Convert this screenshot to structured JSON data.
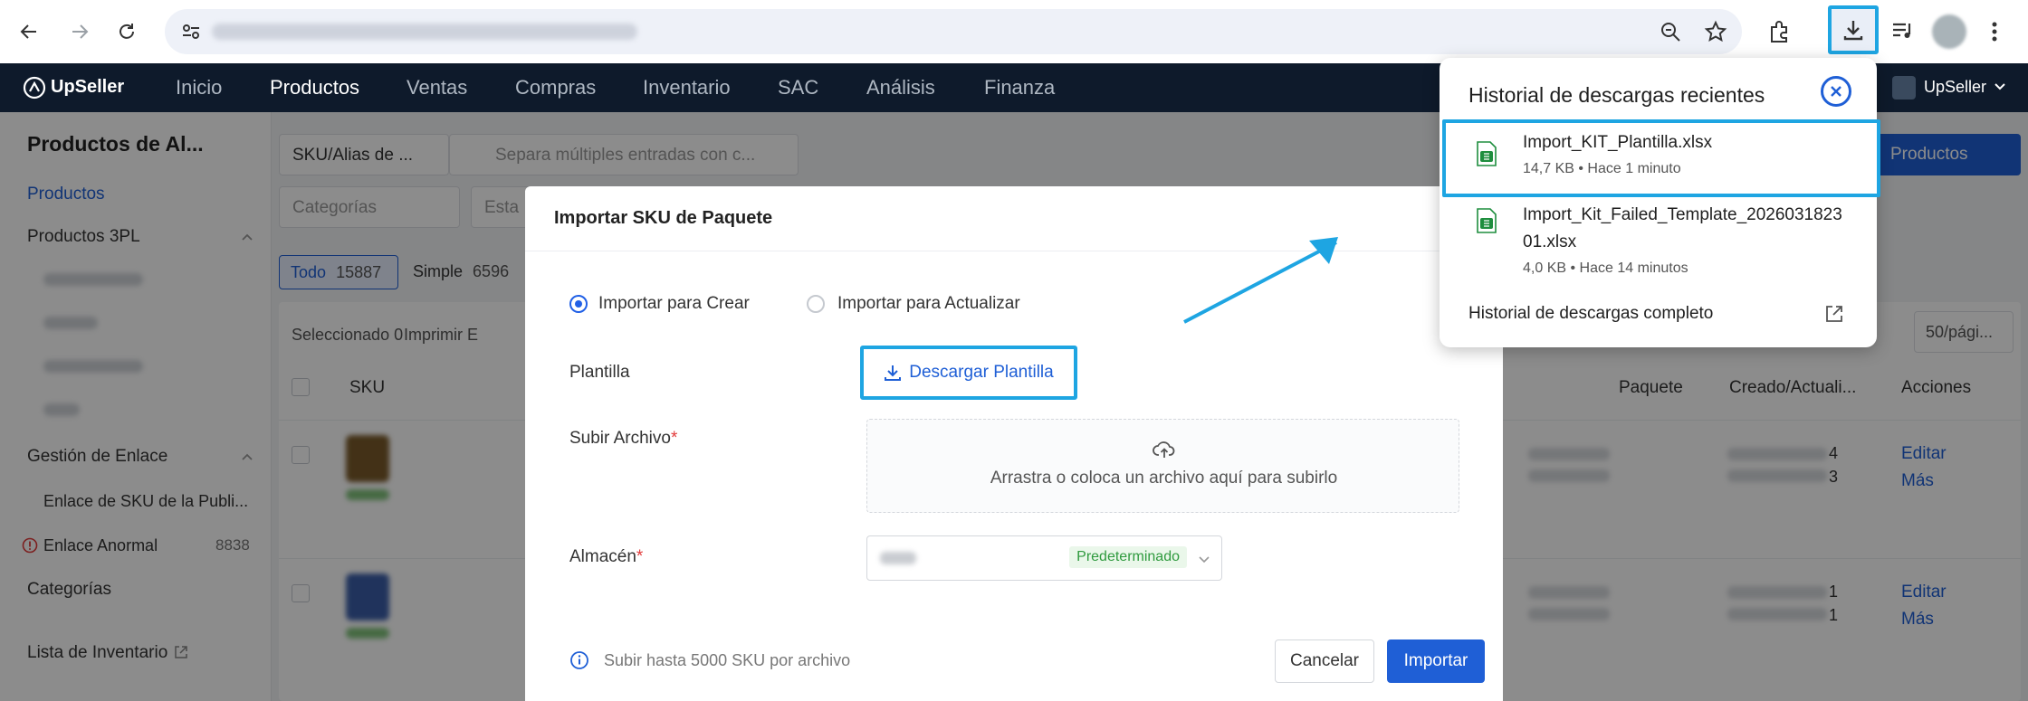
{
  "browser": {
    "icons": [
      "back-arrow-icon",
      "forward-arrow-icon",
      "reload-icon",
      "site-settings-icon",
      "zoom-icon",
      "star-icon",
      "extensions-icon",
      "download-icon",
      "media-control-icon",
      "more-vert-icon"
    ]
  },
  "app": {
    "logo": "UpSeller",
    "nav": [
      "Inicio",
      "Productos",
      "Ventas",
      "Compras",
      "Inventario",
      "SAC",
      "Análisis",
      "Finanza"
    ],
    "nav_active": "Productos",
    "account_name": "UpSeller"
  },
  "sidebar": {
    "title": "Productos de Al...",
    "items": [
      {
        "label": "Productos",
        "active": true
      },
      {
        "label": "Productos 3PL"
      },
      {
        "label": "Gestión de Enlace"
      },
      {
        "label": "Enlace de SKU de la Publi..."
      },
      {
        "label": "Enlace Anormal",
        "count": "8838"
      },
      {
        "label": "Categorías"
      },
      {
        "label": "Lista de Inventario"
      }
    ]
  },
  "main": {
    "search_type": "SKU/Alias de ...",
    "search_placeholder": "Separa múltiples entradas con c...",
    "categories_placeholder": "Categorías",
    "state_placeholder": "Esta",
    "tabs": [
      {
        "label": "Todo",
        "count": "15887"
      },
      {
        "label": "Simple",
        "count": "6596"
      }
    ],
    "selected_label": "Seleccionado",
    "selected_count": "0",
    "print_label": "Imprimir E",
    "page_size": "50/pági...",
    "add_products": "Productos",
    "columns": [
      "SKU",
      "Paquete",
      "Creado/Actuali...",
      "Acciones"
    ],
    "row_actions": [
      "Editar",
      "Más"
    ],
    "rows": [
      {
        "c1": "4",
        "c2": "3"
      },
      {
        "c1": "1",
        "c2": "1"
      }
    ]
  },
  "modal": {
    "title": "Importar SKU de Paquete",
    "option_create": "Importar para Crear",
    "option_update": "Importar para Actualizar",
    "template_label": "Plantilla",
    "download_template": "Descargar Plantilla",
    "upload_label": "Subir Archivo",
    "dropzone_text": "Arrastra o coloca un archivo aquí para subirlo",
    "warehouse_label": "Almacén",
    "warehouse_tag": "Predeterminado",
    "info_text": "Subir hasta 5000 SKU por archivo",
    "cancel": "Cancelar",
    "import": "Importar"
  },
  "downloads": {
    "title": "Historial de descargas recientes",
    "items": [
      {
        "name": "Import_KIT_Plantilla.xlsx",
        "meta": "14,7 KB • Hace 1 minuto"
      },
      {
        "name_line1": "Import_Kit_Failed_Template_2026031823",
        "name_line2": "01.xlsx",
        "meta": "4,0 KB • Hace 14 minutos"
      }
    ],
    "full_history": "Historial de descargas completo"
  },
  "colors": {
    "primary": "#1f5fd6",
    "highlight": "#1ea5e2",
    "navbar": "#0e1a2b",
    "xlsx_green": "#1e8e3e"
  }
}
